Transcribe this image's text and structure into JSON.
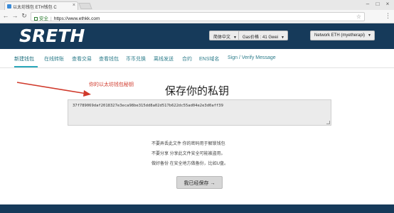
{
  "browser": {
    "tab_title": "以太坊钱包 ETH钱包 C",
    "address_secure_label": "安全",
    "address_url": "https://www.ethkk.com"
  },
  "header": {
    "logo_text": "SRETH",
    "language_label": "简体中文",
    "gas_label": "Gas价格 : 41 Gwei",
    "network_label": "Network ETH (myetherapi)"
  },
  "nav": {
    "items": [
      "新建钱包",
      "在线转账",
      "查看交易",
      "查看钱包",
      "币币兑换",
      "离线发送",
      "合约",
      "ENS域名",
      "Sign / Verify Message"
    ]
  },
  "main": {
    "annotation": "你的以太坊钱包秘钥",
    "title": "保存你的私钥",
    "private_key": "37f789069daf2018327e3eca98be315dd8a02d517b622dc55ad04e2e3d0aff39",
    "warnings": [
      "不要弄丢此文件 你的密码用于解锁钱包",
      "不要分享 分享此文件安全可能被盗用。",
      "做好备份 在安全地方做备份，比如U盘。"
    ],
    "confirm_button": "我已经保存 →"
  },
  "colors": {
    "header_bg": "#163a5a",
    "nav_link": "#2f7e8c",
    "annotation": "#d0392b"
  }
}
